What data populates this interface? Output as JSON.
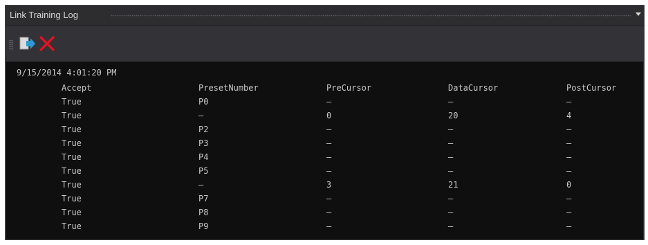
{
  "window": {
    "title": "Link Training Log"
  },
  "toolbar": {
    "buttons": [
      {
        "icon": "export-icon"
      },
      {
        "icon": "delete-icon",
        "color": "#e81123"
      }
    ]
  },
  "log": {
    "timestamp": "9/15/2014 4:01:20 PM",
    "columns": [
      "Accept",
      "PresetNumber",
      "PreCursor",
      "DataCursor",
      "PostCursor"
    ],
    "rows": [
      [
        "True",
        "P0",
        "–",
        "–",
        "–"
      ],
      [
        "True",
        "–",
        "0",
        "20",
        "4"
      ],
      [
        "True",
        "P2",
        "–",
        "–",
        "–"
      ],
      [
        "True",
        "P3",
        "–",
        "–",
        "–"
      ],
      [
        "True",
        "P4",
        "–",
        "–",
        "–"
      ],
      [
        "True",
        "P5",
        "–",
        "–",
        "–"
      ],
      [
        "True",
        "–",
        "3",
        "21",
        "0"
      ],
      [
        "True",
        "P7",
        "–",
        "–",
        "–"
      ],
      [
        "True",
        "P8",
        "–",
        "–",
        "–"
      ],
      [
        "True",
        "P9",
        "–",
        "–",
        "–"
      ]
    ]
  }
}
